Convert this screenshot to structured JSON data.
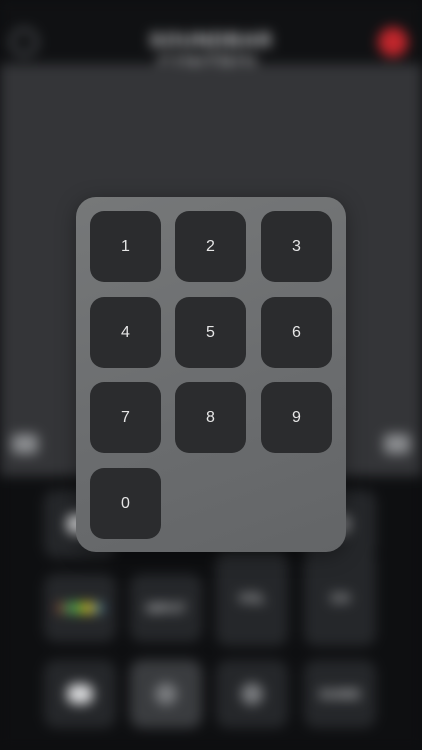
{
  "header": {
    "title": "SOUNDBAR CONTROL"
  },
  "keypad": {
    "keys": [
      "1",
      "2",
      "3",
      "4",
      "5",
      "6",
      "7",
      "8",
      "9",
      "0"
    ]
  },
  "remote": {
    "labels": [
      "VOL",
      "CH",
      "INPUT",
      "GUIDE"
    ]
  },
  "colors": {
    "accent_red": "#c0262c",
    "panel": "#6e7072",
    "key": "#2b2c2e"
  }
}
